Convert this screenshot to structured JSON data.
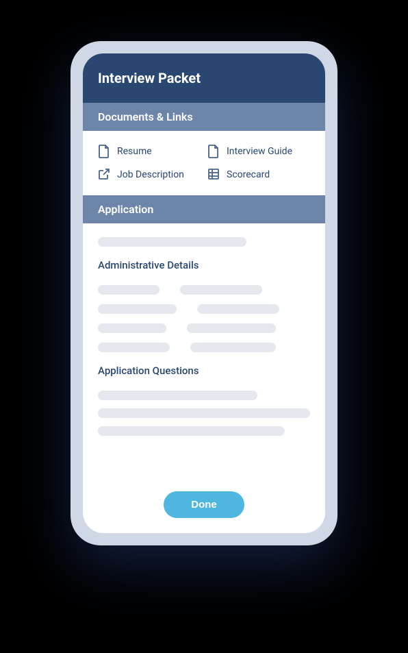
{
  "header": {
    "title": "Interview Packet"
  },
  "sections": {
    "documents": {
      "title": "Documents & Links",
      "items": {
        "resume": "Resume",
        "interview_guide": "Interview Guide",
        "job_description": "Job Description",
        "scorecard": "Scorecard"
      }
    },
    "application": {
      "title": "Application",
      "admin_details_label": "Administrative Details",
      "questions_label": "Application Questions"
    }
  },
  "actions": {
    "done": "Done"
  }
}
